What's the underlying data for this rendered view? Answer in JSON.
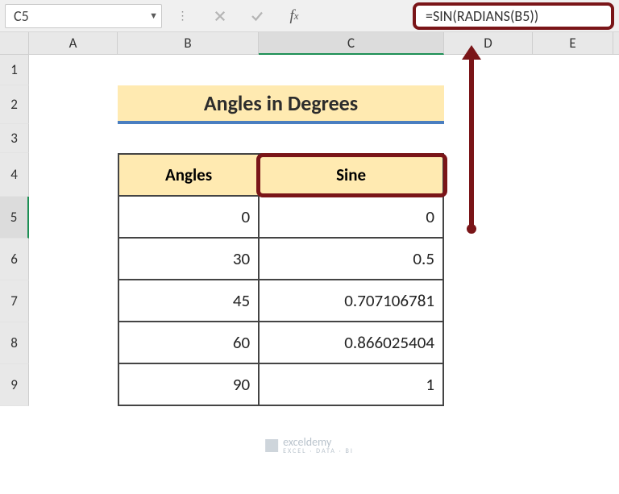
{
  "namebox": "C5",
  "formula": "=SIN(RADIANS(B5))",
  "columns": [
    "A",
    "B",
    "C",
    "D",
    "E"
  ],
  "rows": [
    "1",
    "2",
    "3",
    "4",
    "5",
    "6",
    "7",
    "8",
    "9"
  ],
  "title": "Angles in Degrees",
  "table": {
    "headers": {
      "angles": "Angles",
      "sine": "Sine"
    },
    "data": [
      {
        "angle": "0",
        "sine": "0"
      },
      {
        "angle": "30",
        "sine": "0.5"
      },
      {
        "angle": "45",
        "sine": "0.707106781"
      },
      {
        "angle": "60",
        "sine": "0.866025404"
      },
      {
        "angle": "90",
        "sine": "1"
      }
    ]
  },
  "watermark": {
    "brand": "exceldemy",
    "tag": "EXCEL · DATA · BI"
  }
}
